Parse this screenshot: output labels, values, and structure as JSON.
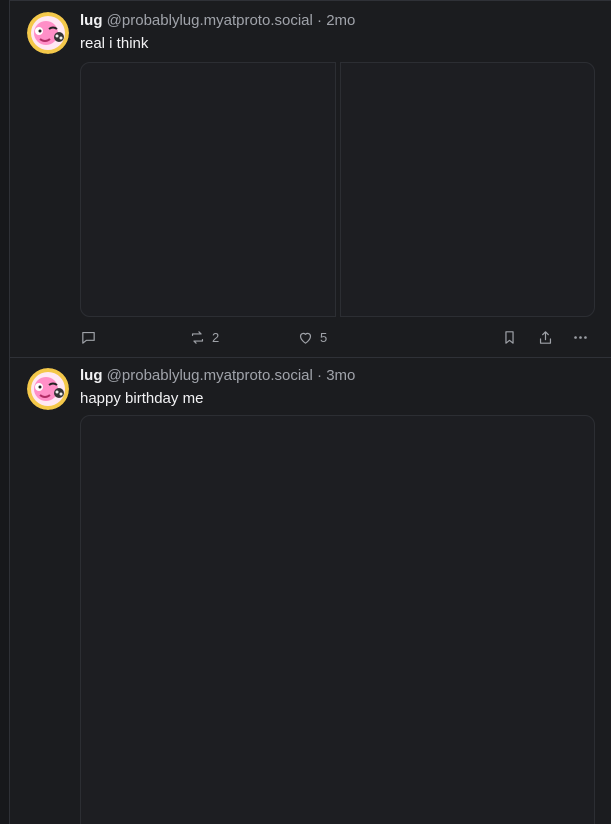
{
  "posts": [
    {
      "author": "lug",
      "handle": "@probablylug.myatproto.social",
      "separator": "·",
      "time": "2mo",
      "text": "real i think",
      "repost_count": "2",
      "like_count": "5"
    },
    {
      "author": "lug",
      "handle": "@probablylug.myatproto.social",
      "separator": "·",
      "time": "3mo",
      "text": "happy birthday me"
    }
  ],
  "colors": {
    "background": "#1b1c1f",
    "border": "#2f3137",
    "muted_text": "#a0a3aa",
    "avatar_pink": "#ff8fc7",
    "avatar_yellow": "#f4c84a"
  },
  "icons": [
    "reply-icon",
    "repost-icon",
    "like-icon",
    "bookmark-icon",
    "share-icon",
    "more-icon"
  ]
}
